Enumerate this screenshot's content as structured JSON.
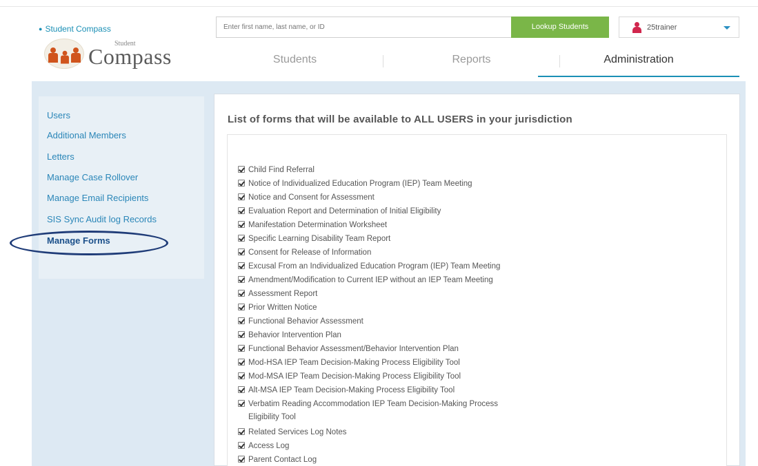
{
  "header": {
    "breadcrumb": "Student Compass",
    "logo_small": "Student",
    "logo_big": "Compass",
    "search_placeholder": "Enter first name, last name, or ID",
    "lookup_label": "Lookup Students",
    "username": "25trainer"
  },
  "tabs": [
    "Students",
    "Reports",
    "Administration"
  ],
  "sidebar": {
    "items": [
      "Users",
      "Additional Members",
      "Letters",
      "Manage Case Rollover",
      "Manage Email Recipients",
      "SIS Sync Audit log Records",
      "Manage Forms"
    ],
    "active": "Manage Forms"
  },
  "main": {
    "title": "List of forms that will be available to ALL USERS in your jurisdiction",
    "forms": [
      "Child Find Referral",
      "Notice of Individualized Education Program (IEP) Team Meeting",
      "Notice and Consent for Assessment",
      "Evaluation Report and Determination of Initial Eligibility",
      "Manifestation Determination Worksheet",
      "Specific Learning Disability Team Report",
      "Consent for Release of Information",
      "Excusal From an Individualized Education Program (IEP) Team Meeting",
      "Amendment/Modification to Current IEP without an IEP Team Meeting",
      "Assessment Report",
      "Prior Written Notice",
      "Functional Behavior Assessment",
      "Behavior Intervention Plan",
      "Functional Behavior Assessment/Behavior Intervention Plan",
      "Mod-HSA IEP Team Decision-Making Process Eligibility Tool",
      "Mod-MSA IEP Team Decision-Making Process Eligibility Tool",
      "Alt-MSA IEP Team Decision-Making Process Eligibility Tool",
      "Verbatim Reading Accommodation IEP Team Decision-Making Process",
      "Eligibility Tool",
      "Related Services Log Notes",
      "Access Log",
      "Parent Contact Log"
    ]
  },
  "colors": {
    "accent": "#1a8fb5",
    "lookup_green": "#7ab648",
    "user_icon": "#d1264d",
    "highlight_oval": "#1f3c78"
  }
}
